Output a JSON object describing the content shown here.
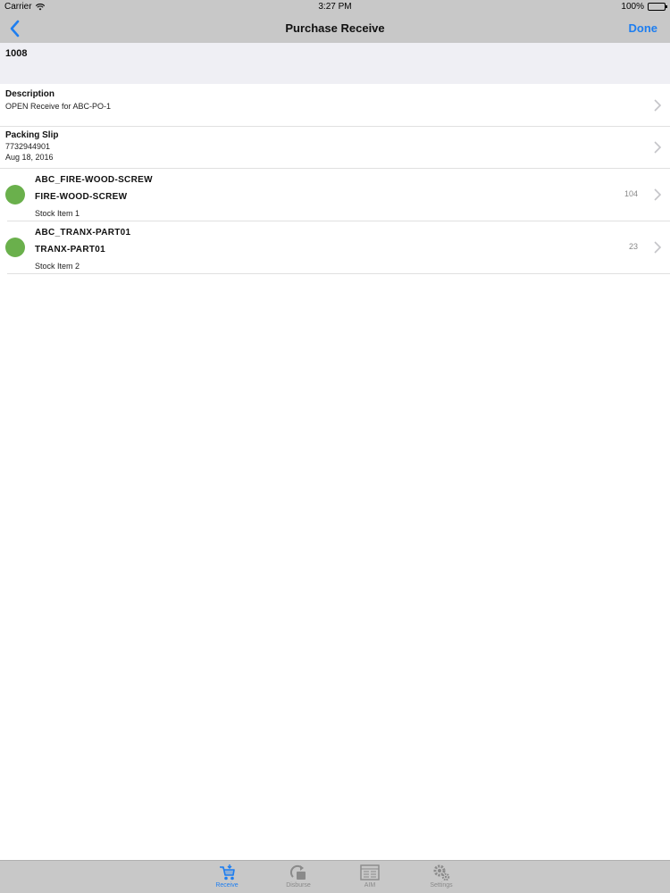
{
  "status_bar": {
    "carrier": "Carrier",
    "time": "3:27 PM",
    "battery": "100%",
    "battery_level": 1.0
  },
  "nav": {
    "title": "Purchase Receive",
    "done_label": "Done"
  },
  "po_number": "1008",
  "description": {
    "label": "Description",
    "value": "OPEN Receive for ABC-PO-1"
  },
  "packing_slip": {
    "label": "Packing Slip",
    "number": "7732944901",
    "date": "Aug 18, 2016"
  },
  "items": [
    {
      "code": "ABC_FIRE-WOOD-SCREW",
      "name": "FIRE-WOOD-SCREW",
      "type": "Stock Item 1",
      "qty": "104",
      "status_color": "#6ab04c"
    },
    {
      "code": "ABC_TRANX-PART01",
      "name": "TRANX-PART01",
      "type": "Stock Item 2",
      "qty": "23",
      "status_color": "#6ab04c"
    }
  ],
  "tabs": [
    {
      "label": "Receive",
      "icon": "receive-cart-icon",
      "active": true
    },
    {
      "label": "Disburse",
      "icon": "disburse-icon",
      "active": false
    },
    {
      "label": "AIM",
      "icon": "aim-grid-icon",
      "active": false
    },
    {
      "label": "Settings",
      "icon": "gears-icon",
      "active": false
    }
  ],
  "colors": {
    "accent": "#1e7ef0",
    "bar": "#c8c8c8",
    "status_green": "#6ab04c"
  }
}
